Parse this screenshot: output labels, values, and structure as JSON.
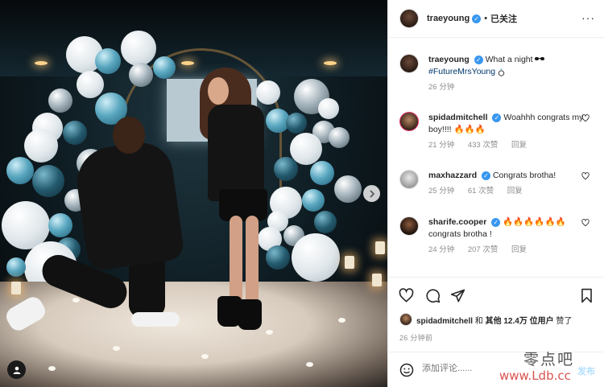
{
  "header": {
    "username": "traeyoung",
    "dot": "•",
    "follow_status": "已关注",
    "more": "···"
  },
  "caption": {
    "username": "traeyoung",
    "text": "What a night",
    "hashtag": "#FutureMrsYoung",
    "time": "26 分钟"
  },
  "comments": [
    {
      "username": "spidadmitchell",
      "text": "Woahhh congrats my boy!!!! 🔥🔥🔥",
      "time": "21 分钟",
      "likes": "433 次赞",
      "reply": "回复"
    },
    {
      "username": "maxhazzard",
      "text": "Congrats brotha!",
      "time": "25 分钟",
      "likes": "61 次赞",
      "reply": "回复"
    },
    {
      "username": "sharife.cooper",
      "text": "🔥🔥🔥🔥🔥🔥 congrats brotha !",
      "time": "24 分钟",
      "likes": "207 次赞",
      "reply": "回复"
    }
  ],
  "likes_line": {
    "username": "spidadmitchell",
    "and": "和",
    "others": "其他 12.4万 位用户",
    "liked": "赞了"
  },
  "post_time": "26 分钟前",
  "comment_input": {
    "placeholder": "添加评论......"
  },
  "post_button": "发布",
  "watermark": {
    "line1": "零点吧",
    "line2": "www.Ldb.cc"
  },
  "colors": {
    "verified": "#3897f0",
    "hashtag": "#00376b",
    "post_button": "#b2dffc",
    "meta": "#8e8e8e"
  },
  "icons": [
    "verified-icon",
    "more-icon",
    "heart-icon",
    "comment-icon",
    "share-icon",
    "bookmark-icon",
    "emoji-icon",
    "chevron-right-icon",
    "tag-user-icon"
  ]
}
